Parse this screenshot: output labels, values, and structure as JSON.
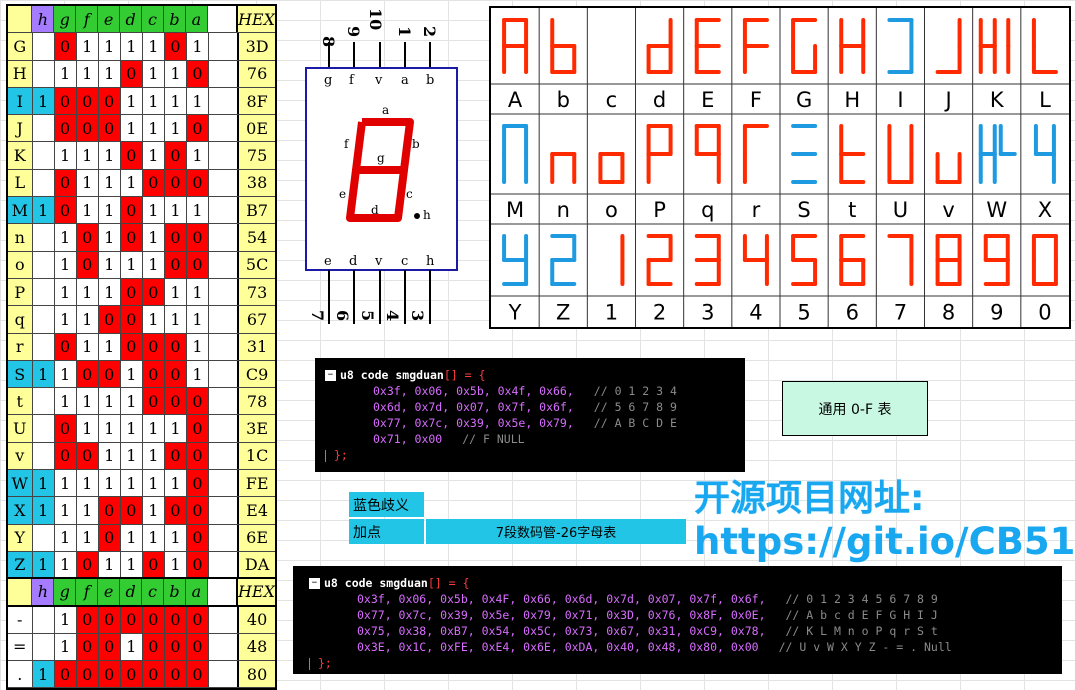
{
  "truth_table": {
    "header": [
      "",
      "h",
      "g",
      "f",
      "e",
      "d",
      "c",
      "b",
      "a",
      "",
      "HEX"
    ],
    "rows": [
      {
        "label": "G",
        "bits": [
          "",
          "0",
          "1",
          "1",
          "1",
          "1",
          "0",
          "1"
        ],
        "hex": "3D",
        "label_cyan": false,
        "h_cyan": false
      },
      {
        "label": "H",
        "bits": [
          "",
          "1",
          "1",
          "1",
          "0",
          "1",
          "1",
          "0"
        ],
        "hex": "76",
        "label_cyan": false,
        "h_cyan": false
      },
      {
        "label": "I",
        "bits": [
          "1",
          "0",
          "0",
          "0",
          "1",
          "1",
          "1",
          "1"
        ],
        "hex": "8F",
        "label_cyan": true,
        "h_cyan": true
      },
      {
        "label": "J",
        "bits": [
          "",
          "0",
          "0",
          "0",
          "1",
          "1",
          "1",
          "0"
        ],
        "hex": "0E",
        "label_cyan": false,
        "h_cyan": false
      },
      {
        "label": "K",
        "bits": [
          "",
          "1",
          "1",
          "1",
          "0",
          "1",
          "0",
          "1"
        ],
        "hex": "75",
        "label_cyan": false,
        "h_cyan": false
      },
      {
        "label": "L",
        "bits": [
          "",
          "0",
          "1",
          "1",
          "1",
          "0",
          "0",
          "0"
        ],
        "hex": "38",
        "label_cyan": false,
        "h_cyan": false
      },
      {
        "label": "M",
        "bits": [
          "1",
          "0",
          "1",
          "1",
          "0",
          "1",
          "1",
          "1"
        ],
        "hex": "B7",
        "label_cyan": true,
        "h_cyan": true
      },
      {
        "label": "n",
        "bits": [
          "",
          "1",
          "0",
          "1",
          "0",
          "1",
          "0",
          "0"
        ],
        "hex": "54",
        "label_cyan": false,
        "h_cyan": false
      },
      {
        "label": "o",
        "bits": [
          "",
          "1",
          "0",
          "1",
          "1",
          "1",
          "0",
          "0"
        ],
        "hex": "5C",
        "label_cyan": false,
        "h_cyan": false
      },
      {
        "label": "P",
        "bits": [
          "",
          "1",
          "1",
          "1",
          "0",
          "0",
          "1",
          "1"
        ],
        "hex": "73",
        "label_cyan": false,
        "h_cyan": false
      },
      {
        "label": "q",
        "bits": [
          "",
          "1",
          "1",
          "0",
          "0",
          "1",
          "1",
          "1"
        ],
        "hex": "67",
        "label_cyan": false,
        "h_cyan": false
      },
      {
        "label": "r",
        "bits": [
          "",
          "0",
          "1",
          "1",
          "0",
          "0",
          "0",
          "1"
        ],
        "hex": "31",
        "label_cyan": false,
        "h_cyan": false
      },
      {
        "label": "S",
        "bits": [
          "1",
          "1",
          "0",
          "0",
          "1",
          "0",
          "0",
          "1"
        ],
        "hex": "C9",
        "label_cyan": true,
        "h_cyan": true
      },
      {
        "label": "t",
        "bits": [
          "",
          "1",
          "1",
          "1",
          "1",
          "0",
          "0",
          "0"
        ],
        "hex": "78",
        "label_cyan": false,
        "h_cyan": false
      },
      {
        "label": "U",
        "bits": [
          "",
          "0",
          "1",
          "1",
          "1",
          "1",
          "1",
          "0"
        ],
        "hex": "3E",
        "label_cyan": false,
        "h_cyan": false
      },
      {
        "label": "v",
        "bits": [
          "",
          "0",
          "0",
          "1",
          "1",
          "1",
          "0",
          "0"
        ],
        "hex": "1C",
        "label_cyan": false,
        "h_cyan": false
      },
      {
        "label": "W",
        "bits": [
          "1",
          "1",
          "1",
          "1",
          "1",
          "1",
          "1",
          "0"
        ],
        "hex": "FE",
        "label_cyan": true,
        "h_cyan": true
      },
      {
        "label": "X",
        "bits": [
          "1",
          "1",
          "1",
          "0",
          "0",
          "1",
          "0",
          "0"
        ],
        "hex": "E4",
        "label_cyan": true,
        "h_cyan": true
      },
      {
        "label": "Y",
        "bits": [
          "",
          "1",
          "1",
          "0",
          "1",
          "1",
          "1",
          "0"
        ],
        "hex": "6E",
        "label_cyan": false,
        "h_cyan": false
      },
      {
        "label": "Z",
        "bits": [
          "1",
          "1",
          "0",
          "1",
          "1",
          "0",
          "1",
          "0"
        ],
        "hex": "DA",
        "label_cyan": true,
        "h_cyan": true
      }
    ],
    "extra_rows": [
      {
        "label": "-",
        "bits": [
          "",
          "1",
          "0",
          "0",
          "0",
          "0",
          "0",
          "0"
        ],
        "hex": "40",
        "h_cyan": false
      },
      {
        "label": "=",
        "bits": [
          "",
          "1",
          "0",
          "0",
          "1",
          "0",
          "0",
          "0"
        ],
        "hex": "48",
        "h_cyan": false
      },
      {
        "label": ".",
        "bits": [
          "1",
          "0",
          "0",
          "0",
          "0",
          "0",
          "0",
          "0"
        ],
        "hex": "80",
        "h_cyan": true
      }
    ]
  },
  "diagram": {
    "top_pins": [
      "10",
      "9",
      "8",
      "1",
      "2"
    ],
    "top_pin_display": [
      "8",
      "9",
      "10",
      "1",
      "2"
    ],
    "top_labels": [
      "g",
      "f",
      "v",
      "a",
      "b"
    ],
    "bottom_labels": [
      "e",
      "d",
      "v",
      "c",
      "h"
    ],
    "bottom_pins": [
      "7",
      "6",
      "5",
      "4",
      "3"
    ],
    "segment_labels": {
      "a": "a",
      "b": "b",
      "c": "c",
      "d": "d",
      "e": "e",
      "f": "f",
      "g": "g",
      "h": "h"
    }
  },
  "char_table": {
    "row1": [
      "A",
      "b",
      "c",
      "d",
      "E",
      "F",
      "G",
      "H",
      "I",
      "J",
      "K",
      "L"
    ],
    "row2": [
      "M",
      "n",
      "o",
      "P",
      "q",
      "r",
      "S",
      "t",
      "U",
      "v",
      "W",
      "X"
    ],
    "row3": [
      "Y",
      "Z",
      "1",
      "2",
      "3",
      "4",
      "5",
      "6",
      "7",
      "8",
      "9",
      "0"
    ],
    "glyphs_row1": [
      "A",
      "b",
      "C",
      "d",
      "E",
      "F",
      "G",
      "H",
      "]",
      "J",
      "AL",
      "L"
    ],
    "glyphs_row2": [
      "n",
      "n",
      "o",
      "P",
      "q",
      "r",
      "3",
      "t",
      "U",
      "u",
      "H4",
      "4"
    ],
    "glyphs_row3": [
      "y",
      "d",
      "1",
      "2",
      "3",
      "4",
      "5",
      "6",
      "7",
      "8",
      "9",
      "0"
    ],
    "colors": {
      "red": "#ff2a00",
      "blue": "#1e9ae0"
    }
  },
  "code_top": {
    "header": "u8 code smgduan",
    "open": "[] = {",
    "lines": [
      {
        "code": "0x3f, 0x06, 0x5b, 0x4f, 0x66,",
        "comment": "// 0 1 2 3 4"
      },
      {
        "code": "0x6d, 0x7d, 0x07, 0x7f, 0x6f,",
        "comment": "// 5 6 7 8 9"
      },
      {
        "code": "0x77, 0x7c, 0x39, 0x5e, 0x79,",
        "comment": "// A B C D E"
      },
      {
        "code": "0x71, 0x00",
        "comment": "// F NULL"
      }
    ],
    "close": "};"
  },
  "code_bottom": {
    "header": "u8 code smgduan",
    "open": "[] = {",
    "lines": [
      {
        "code": "0x3f, 0x06, 0x5b, 0x4F, 0x66, 0x6d, 0x7d, 0x07, 0x7f, 0x6f,",
        "comment": "// 0 1 2 3 4 5 6 7 8 9"
      },
      {
        "code": "0x77, 0x7c, 0x39, 0x5e, 0x79, 0x71, 0x3D, 0x76, 0x8F, 0x0E,",
        "comment": "// A b c d E F G H I J"
      },
      {
        "code": "0x75, 0x38, 0xB7, 0x54, 0x5C, 0x73, 0x67, 0x31, 0xC9, 0x78,",
        "comment": "// K L M n o P q r S t"
      },
      {
        "code": "0x3E, 0x1C, 0xFE, 0xE4, 0x6E, 0xDA, 0x40, 0x48, 0x80, 0x00",
        "comment": "// U v W X Y Z - = . Null"
      }
    ],
    "close": "};"
  },
  "general_button": "通用 0-F 表",
  "legend": {
    "blue_meaning": "蓝色歧义",
    "dot": "加点",
    "caption": "7段数码管-26字母表"
  },
  "project": {
    "title": "开源项目网址:",
    "url": "https://git.io/CB51"
  }
}
